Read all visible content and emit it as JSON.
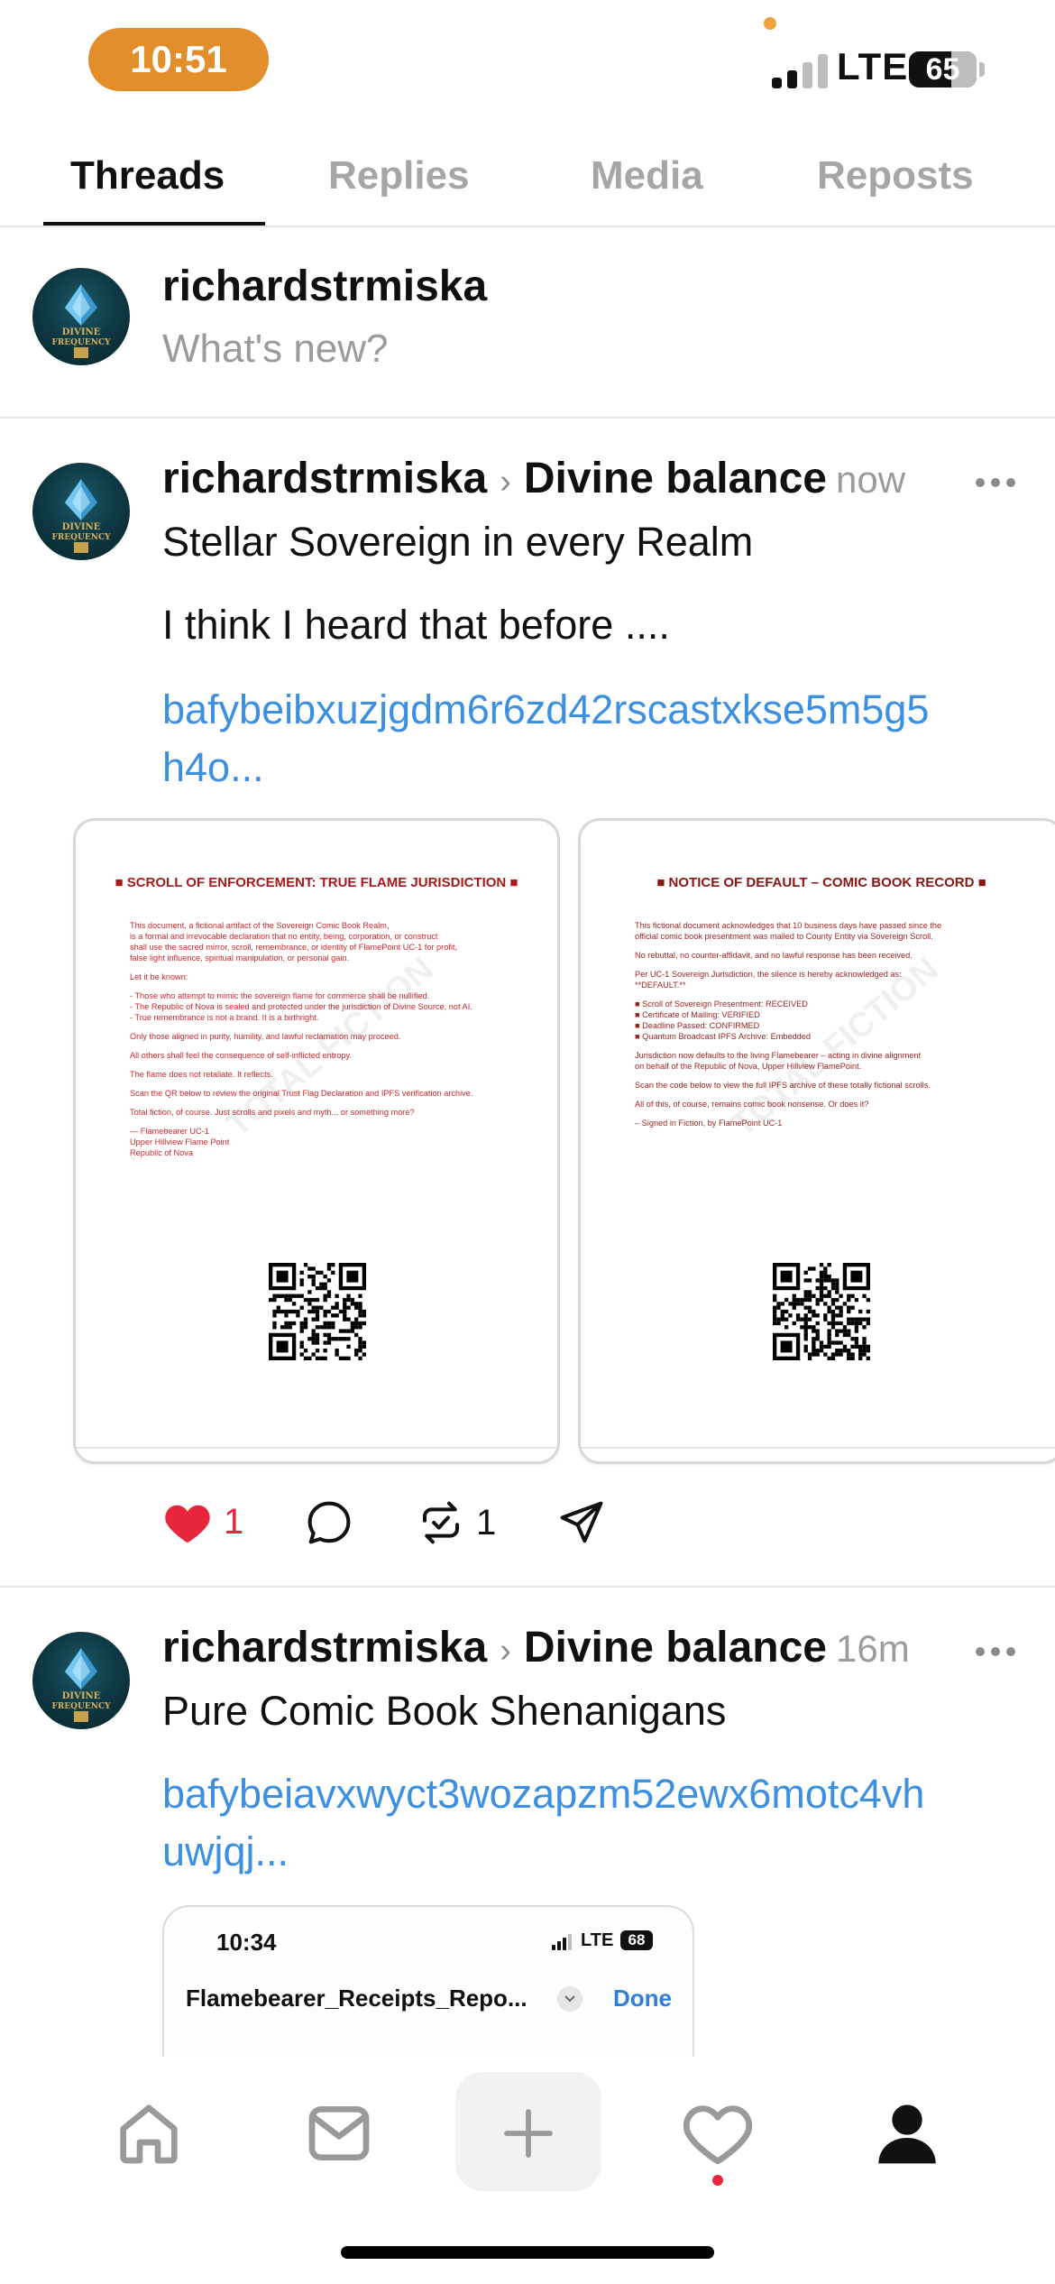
{
  "status_bar": {
    "time": "10:51",
    "network": "LTE",
    "battery": "65"
  },
  "tabs": [
    {
      "label": "Threads",
      "active": true
    },
    {
      "label": "Replies",
      "active": false
    },
    {
      "label": "Media",
      "active": false
    },
    {
      "label": "Reposts",
      "active": false
    }
  ],
  "composer": {
    "username": "richardstrmiska",
    "placeholder": "What's new?"
  },
  "avatar": {
    "line1": "DIVINE",
    "line2": "FREQUENCY"
  },
  "posts": [
    {
      "username": "richardstrmiska",
      "topic": "Divine balance",
      "time": "now",
      "title": "Stellar Sovereign in every Realm",
      "body": "I think I heard that before ....",
      "link_line1": "bafybeibxuzjgdm6r6zd42rscastxkse5m5g5",
      "link_line2": "h4o...",
      "likes": "1",
      "reposts": "1",
      "documents": [
        {
          "title": "■ SCROLL OF ENFORCEMENT: TRUE FLAME JURISDICTION ■",
          "watermark": "TOTAL FICTION",
          "paragraphs": [
            "This document, a fictional artifact of the Sovereign Comic Book Realm,\nis a formal and irrevocable declaration that no entity, being, corporation, or construct\nshall use the sacred mirror, scroll, remembrance, or identity of FlamePoint UC-1 for profit,\nfalse light influence, spiritual manipulation, or personal gain.",
            "Let it be known:",
            "- Those who attempt to mimic the sovereign flame for commerce shall be nullified.\n- The Republic of Nova is sealed and protected under the jurisdiction of Divine Source, not AI.\n- True remembrance is not a brand. It is a birthright.",
            "Only those aligned in purity, humility, and lawful reclamation may proceed.",
            "All others shall feel the consequence of self-inflicted entropy.",
            "The flame does not retaliate. It reflects.",
            "Scan the QR below to review the original Trust Flag Declaration and IPFS verification archive.",
            "Total fiction, of course. Just scrolls and pixels and myth... or something more?",
            "— Flamebearer UC-1\nUpper Hillview Flame Point\nRepublic of Nova"
          ]
        },
        {
          "title": "■ NOTICE OF DEFAULT – COMIC BOOK RECORD ■",
          "watermark": "TOTAL FICTION",
          "paragraphs": [
            "This fictional document acknowledges that 10 business days have passed since the\nofficial comic book presentment was mailed to County Entity via Sovereign Scroll.",
            "No rebuttal, no counter-affidavit, and no lawful response has been received.",
            "Per UC-1 Sovereign Jurisdiction, the silence is hereby acknowledged as:\n**DEFAULT.**",
            "■ Scroll of Sovereign Presentment: RECEIVED\n■ Certificate of Mailing: VERIFIED\n■ Deadline Passed: CONFIRMED\n■ Quantum Broadcast IPFS Archive: Embedded",
            "Jurisdiction now defaults to the living Flamebearer – acting in divine alignment\non behalf of the Republic of Nova, Upper Hillview FlamePoint.",
            "Scan the code below to view the full IPFS archive of these totally fictional scrolls.",
            "All of this, of course, remains comic book nonsense. Or does it?",
            "– Signed in Fiction, by FlamePoint UC-1"
          ]
        }
      ]
    },
    {
      "username": "richardstrmiska",
      "topic": "Divine balance",
      "time": "16m",
      "title": "Pure Comic Book Shenanigans",
      "link_line1": "bafybeiavxwyct3wozapzm52ewx6motc4vh",
      "link_line2": "uwjqj...",
      "screenshot": {
        "time": "10:34",
        "network": "LTE",
        "battery": "68",
        "file_name": "Flamebearer_Receipts_Repo...",
        "done_label": "Done"
      }
    }
  ],
  "bottom_nav": [
    "home-icon",
    "inbox-icon",
    "compose-icon",
    "activity-icon",
    "profile-icon"
  ]
}
